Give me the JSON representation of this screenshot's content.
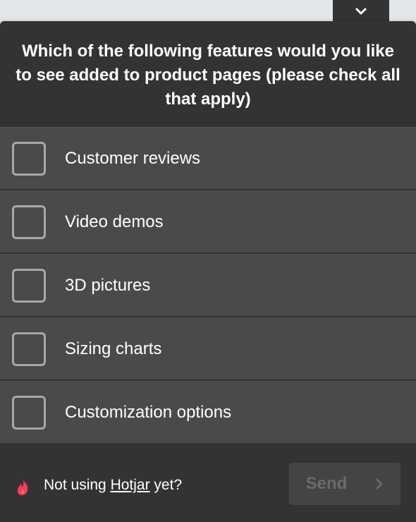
{
  "question": "Which of the following features would you like to see added to product pages (please check all that apply)",
  "options": [
    {
      "label": "Customer reviews",
      "checked": false
    },
    {
      "label": "Video demos",
      "checked": false
    },
    {
      "label": "3D pictures",
      "checked": false
    },
    {
      "label": "Sizing charts",
      "checked": false
    },
    {
      "label": "Customization options",
      "checked": false
    }
  ],
  "footer": {
    "prefix": "Not using ",
    "link": "Hotjar",
    "suffix": " yet?",
    "icon": "hotjar-flame-icon"
  },
  "send_label": "Send",
  "colors": {
    "widget_bg": "#333333",
    "option_bg": "#4a4a4a",
    "checkbox_border": "#a8a8a8",
    "text": "#ffffff",
    "send_bg": "#444444",
    "send_text": "#6a6a6a",
    "hotjar_red": "#fd3a5c"
  }
}
